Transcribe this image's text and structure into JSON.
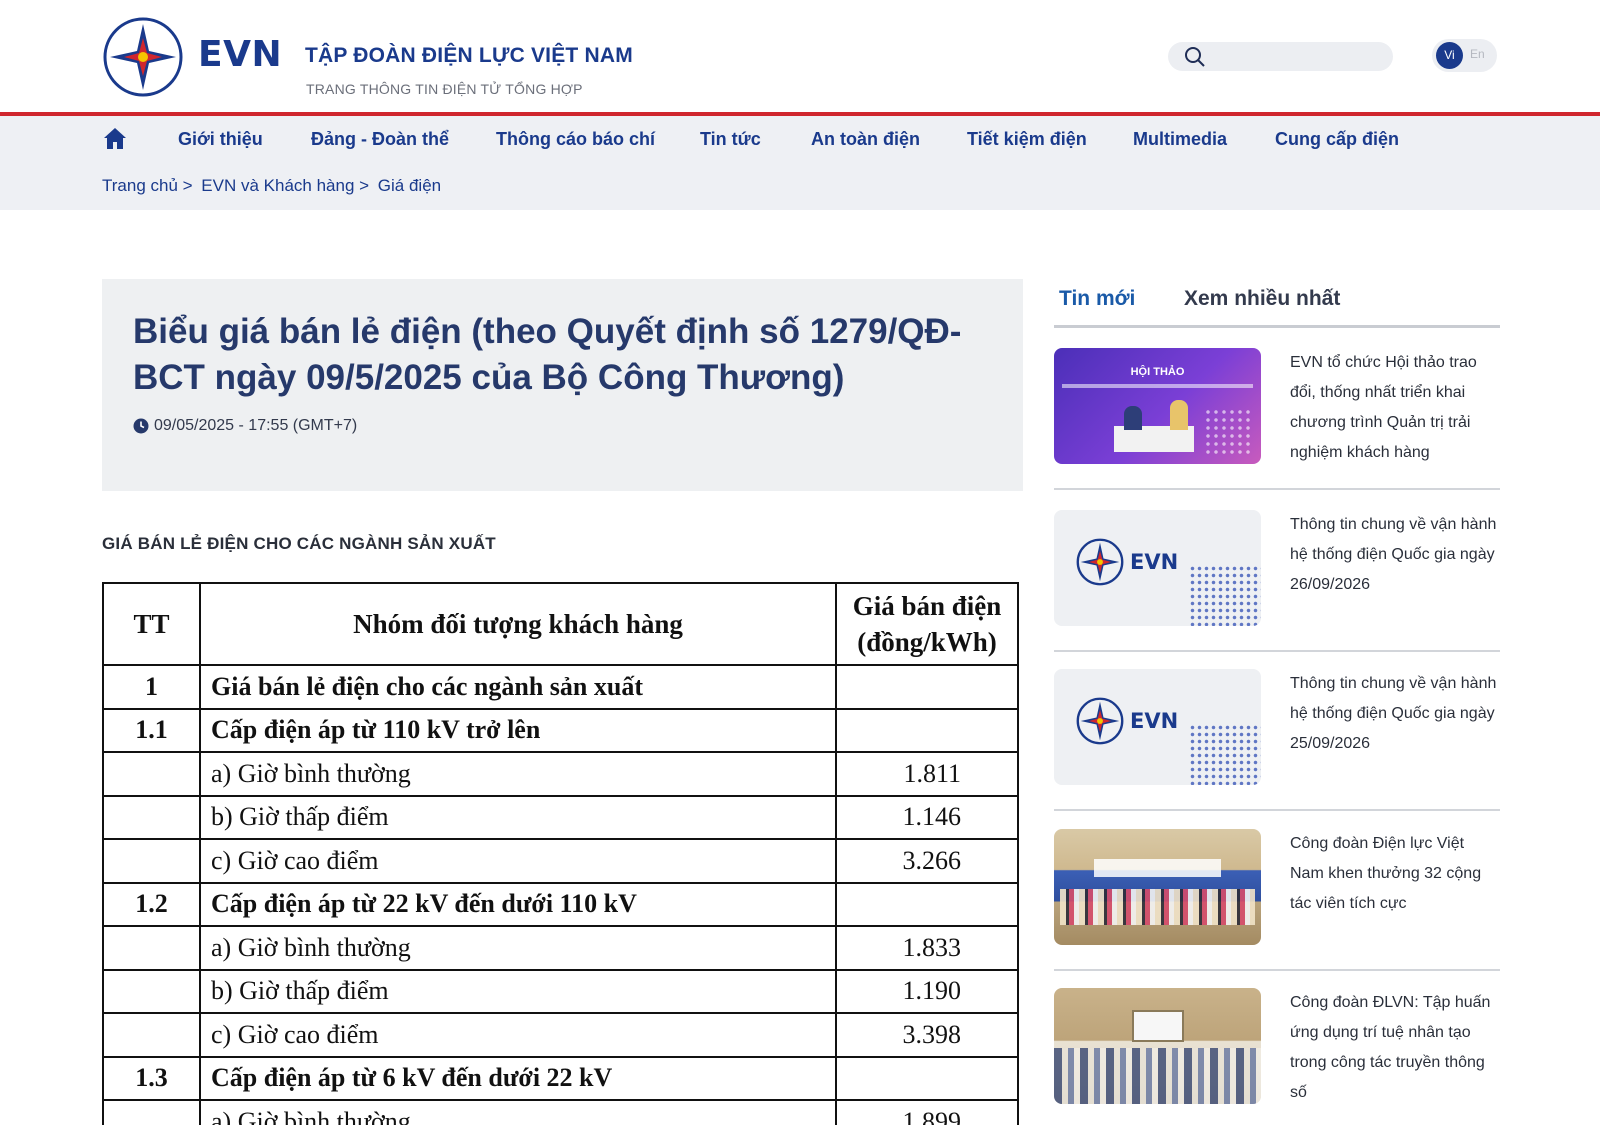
{
  "header": {
    "logo_text": "EVN",
    "corp_name": "TẬP ĐOÀN ĐIỆN LỰC VIỆT NAM",
    "corp_sub": "TRANG THÔNG TIN ĐIỆN TỬ TỔNG HỢP",
    "search_placeholder": "",
    "lang_vi": "Vi",
    "lang_en": "En"
  },
  "nav": {
    "items": [
      "Giới thiệu",
      "Đảng - Đoàn thể",
      "Thông cáo báo chí",
      "Tin tức",
      "An toàn điện",
      "Tiết kiệm điện",
      "Multimedia",
      "Cung cấp điện"
    ]
  },
  "breadcrumb": [
    "Trang chủ >",
    "EVN và Khách hàng >",
    "Giá điện"
  ],
  "article": {
    "title": "Biểu giá bán lẻ điện (theo Quyết định số 1279/QĐ-BCT ngày 09/5/2025 của Bộ Công Thương)",
    "date": "09/05/2025 - 17:55 (GMT+7)",
    "section_heading": "GIÁ BÁN LẺ ĐIỆN CHO CÁC NGÀNH SẢN XUẤT"
  },
  "price_table": {
    "headers": [
      "TT",
      "Nhóm đối tượng khách hàng",
      "Giá bán điện (đồng/kWh)"
    ],
    "rows": [
      [
        "1",
        "Giá bán lẻ điện cho các ngành sản xuất",
        ""
      ],
      [
        "1.1",
        "Cấp điện áp từ 110 kV trở lên",
        ""
      ],
      [
        "",
        "a) Giờ bình thường",
        "1.811"
      ],
      [
        "",
        "b) Giờ thấp điểm",
        "1.146"
      ],
      [
        "",
        "c) Giờ cao điểm",
        "3.266"
      ],
      [
        "1.2",
        "Cấp điện áp từ 22 kV đến dưới 110 kV",
        ""
      ],
      [
        "",
        "a) Giờ bình thường",
        "1.833"
      ],
      [
        "",
        "b) Giờ thấp điểm",
        "1.190"
      ],
      [
        "",
        "c) Giờ cao điểm",
        "3.398"
      ],
      [
        "1.3",
        "Cấp điện áp từ 6 kV đến dưới 22 kV",
        ""
      ],
      [
        "",
        "a) Giờ bình thường",
        "1.899"
      ]
    ]
  },
  "sidebar": {
    "tab_new": "Tin mới",
    "tab_most": "Xem nhiều nhất",
    "news": [
      {
        "text": "EVN tổ chức Hội thảo trao đổi, thống nhất triển khai chương trình Quản trị trải nghiệm khách hàng",
        "thumb": "photo-workshop",
        "thumb_label": "HỘI THẢO"
      },
      {
        "text": "Thông tin chung về vận hành hệ thống điện Quốc gia ngày 26/09/2026",
        "thumb": "evn-logo",
        "thumb_label": "EVN"
      },
      {
        "text": "Thông tin chung về vận hành hệ thống điện Quốc gia ngày 25/09/2026",
        "thumb": "evn-logo",
        "thumb_label": "EVN"
      },
      {
        "text": "Công đoàn Điện lực Việt Nam khen thưởng 32 cộng tác viên tích cực",
        "thumb": "photo-group",
        "thumb_label": ""
      },
      {
        "text": "Công đoàn ĐLVN: Tập huấn ứng dụng trí tuệ nhân tạo trong công tác truyền thông số",
        "thumb": "photo-hall",
        "thumb_label": ""
      }
    ]
  },
  "colors": {
    "brand_blue": "#1a3a8c",
    "accent_red": "#d0262e",
    "link_blue": "#1a5aa8"
  }
}
